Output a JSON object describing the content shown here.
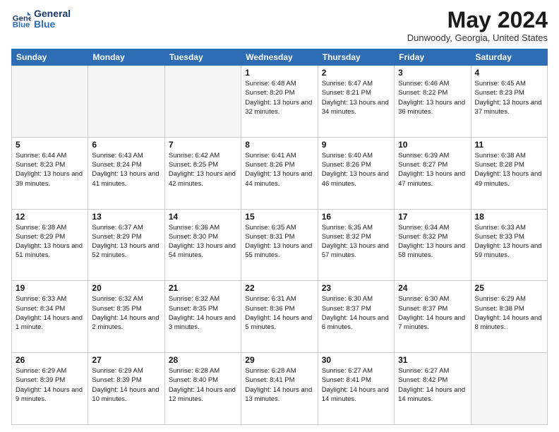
{
  "header": {
    "logo_line1": "General",
    "logo_line2": "Blue",
    "month_title": "May 2024",
    "location": "Dunwoody, Georgia, United States"
  },
  "weekdays": [
    "Sunday",
    "Monday",
    "Tuesday",
    "Wednesday",
    "Thursday",
    "Friday",
    "Saturday"
  ],
  "rows": [
    [
      {
        "num": "",
        "info": "",
        "empty": true
      },
      {
        "num": "",
        "info": "",
        "empty": true
      },
      {
        "num": "",
        "info": "",
        "empty": true
      },
      {
        "num": "1",
        "info": "Sunrise: 6:48 AM\nSunset: 8:20 PM\nDaylight: 13 hours\nand 32 minutes."
      },
      {
        "num": "2",
        "info": "Sunrise: 6:47 AM\nSunset: 8:21 PM\nDaylight: 13 hours\nand 34 minutes."
      },
      {
        "num": "3",
        "info": "Sunrise: 6:46 AM\nSunset: 8:22 PM\nDaylight: 13 hours\nand 36 minutes."
      },
      {
        "num": "4",
        "info": "Sunrise: 6:45 AM\nSunset: 8:23 PM\nDaylight: 13 hours\nand 37 minutes."
      }
    ],
    [
      {
        "num": "5",
        "info": "Sunrise: 6:44 AM\nSunset: 8:23 PM\nDaylight: 13 hours\nand 39 minutes."
      },
      {
        "num": "6",
        "info": "Sunrise: 6:43 AM\nSunset: 8:24 PM\nDaylight: 13 hours\nand 41 minutes."
      },
      {
        "num": "7",
        "info": "Sunrise: 6:42 AM\nSunset: 8:25 PM\nDaylight: 13 hours\nand 42 minutes."
      },
      {
        "num": "8",
        "info": "Sunrise: 6:41 AM\nSunset: 8:26 PM\nDaylight: 13 hours\nand 44 minutes."
      },
      {
        "num": "9",
        "info": "Sunrise: 6:40 AM\nSunset: 8:26 PM\nDaylight: 13 hours\nand 46 minutes."
      },
      {
        "num": "10",
        "info": "Sunrise: 6:39 AM\nSunset: 8:27 PM\nDaylight: 13 hours\nand 47 minutes."
      },
      {
        "num": "11",
        "info": "Sunrise: 6:38 AM\nSunset: 8:28 PM\nDaylight: 13 hours\nand 49 minutes."
      }
    ],
    [
      {
        "num": "12",
        "info": "Sunrise: 6:38 AM\nSunset: 8:29 PM\nDaylight: 13 hours\nand 51 minutes."
      },
      {
        "num": "13",
        "info": "Sunrise: 6:37 AM\nSunset: 8:29 PM\nDaylight: 13 hours\nand 52 minutes."
      },
      {
        "num": "14",
        "info": "Sunrise: 6:36 AM\nSunset: 8:30 PM\nDaylight: 13 hours\nand 54 minutes."
      },
      {
        "num": "15",
        "info": "Sunrise: 6:35 AM\nSunset: 8:31 PM\nDaylight: 13 hours\nand 55 minutes."
      },
      {
        "num": "16",
        "info": "Sunrise: 6:35 AM\nSunset: 8:32 PM\nDaylight: 13 hours\nand 57 minutes."
      },
      {
        "num": "17",
        "info": "Sunrise: 6:34 AM\nSunset: 8:32 PM\nDaylight: 13 hours\nand 58 minutes."
      },
      {
        "num": "18",
        "info": "Sunrise: 6:33 AM\nSunset: 8:33 PM\nDaylight: 13 hours\nand 59 minutes."
      }
    ],
    [
      {
        "num": "19",
        "info": "Sunrise: 6:33 AM\nSunset: 8:34 PM\nDaylight: 14 hours\nand 1 minute."
      },
      {
        "num": "20",
        "info": "Sunrise: 6:32 AM\nSunset: 8:35 PM\nDaylight: 14 hours\nand 2 minutes."
      },
      {
        "num": "21",
        "info": "Sunrise: 6:32 AM\nSunset: 8:35 PM\nDaylight: 14 hours\nand 3 minutes."
      },
      {
        "num": "22",
        "info": "Sunrise: 6:31 AM\nSunset: 8:36 PM\nDaylight: 14 hours\nand 5 minutes."
      },
      {
        "num": "23",
        "info": "Sunrise: 6:30 AM\nSunset: 8:37 PM\nDaylight: 14 hours\nand 6 minutes."
      },
      {
        "num": "24",
        "info": "Sunrise: 6:30 AM\nSunset: 8:37 PM\nDaylight: 14 hours\nand 7 minutes."
      },
      {
        "num": "25",
        "info": "Sunrise: 6:29 AM\nSunset: 8:38 PM\nDaylight: 14 hours\nand 8 minutes."
      }
    ],
    [
      {
        "num": "26",
        "info": "Sunrise: 6:29 AM\nSunset: 8:39 PM\nDaylight: 14 hours\nand 9 minutes."
      },
      {
        "num": "27",
        "info": "Sunrise: 6:29 AM\nSunset: 8:39 PM\nDaylight: 14 hours\nand 10 minutes."
      },
      {
        "num": "28",
        "info": "Sunrise: 6:28 AM\nSunset: 8:40 PM\nDaylight: 14 hours\nand 12 minutes."
      },
      {
        "num": "29",
        "info": "Sunrise: 6:28 AM\nSunset: 8:41 PM\nDaylight: 14 hours\nand 13 minutes."
      },
      {
        "num": "30",
        "info": "Sunrise: 6:27 AM\nSunset: 8:41 PM\nDaylight: 14 hours\nand 14 minutes."
      },
      {
        "num": "31",
        "info": "Sunrise: 6:27 AM\nSunset: 8:42 PM\nDaylight: 14 hours\nand 14 minutes."
      },
      {
        "num": "",
        "info": "",
        "empty": true
      }
    ]
  ]
}
